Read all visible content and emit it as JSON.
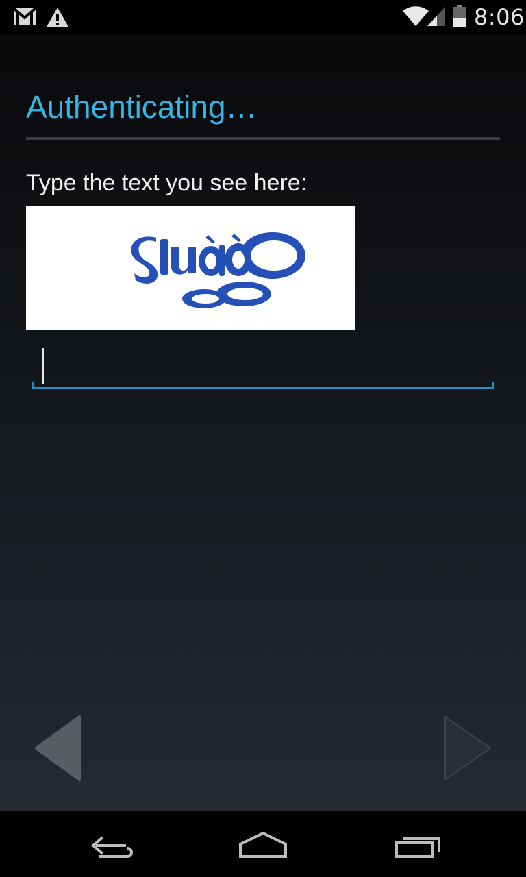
{
  "status_bar": {
    "time": "8:06",
    "icons": [
      "gmail-icon",
      "warning-icon",
      "wifi-icon",
      "signal-icon",
      "battery-icon"
    ]
  },
  "page": {
    "title": "Authenticating…",
    "prompt": "Type the text you see here:",
    "captcha_input": {
      "value": "",
      "placeholder": ""
    }
  },
  "navigation": {
    "prev_icon": "arrow-left-icon",
    "next_icon": "arrow-right-icon"
  },
  "system_nav": {
    "buttons": [
      "back-icon",
      "home-icon",
      "recents-icon"
    ]
  },
  "colors": {
    "accent": "#33b5e5",
    "input_underline": "#1f8fc4",
    "captcha_text": "#2450b8"
  }
}
